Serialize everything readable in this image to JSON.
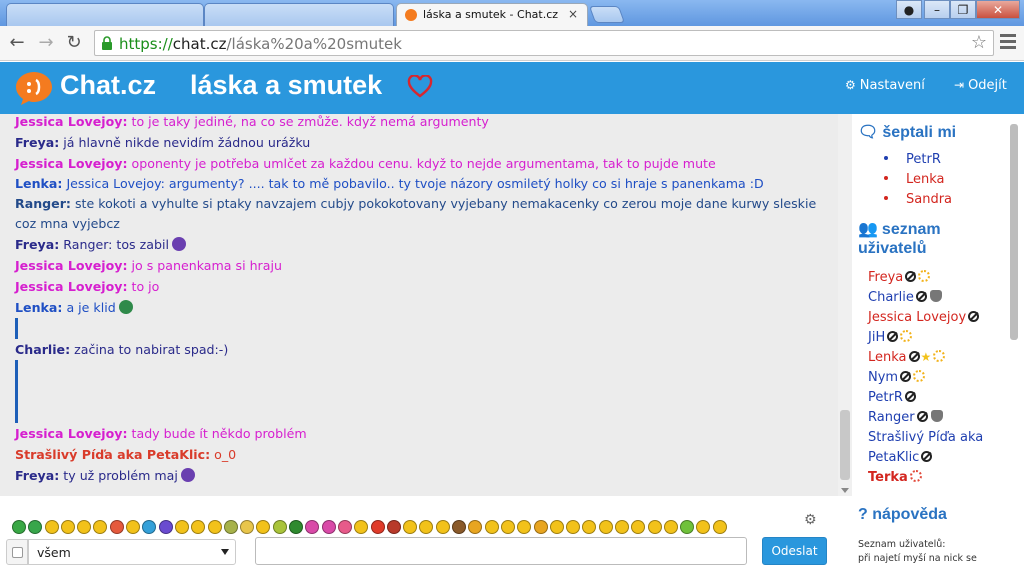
{
  "browser": {
    "tabs": [
      {
        "title": ""
      },
      {
        "title": ""
      },
      {
        "title": "láska a smutek - Chat.cz",
        "close": "×"
      }
    ],
    "url": {
      "scheme": "https://",
      "host": "chat.cz",
      "path": "/láska%20a%20smutek"
    },
    "window_buttons": {
      "min": "–",
      "max": "❐",
      "close": "✕"
    }
  },
  "header": {
    "brand": "Chat.cz",
    "room": "láska a smutek",
    "settings_label": "Nastavení",
    "logout_label": "Odejít",
    "accent": "#2a97dd"
  },
  "chat": {
    "messages": [
      {
        "nick": "Jessica Lovejoy:",
        "text": "to je taky jediné, na co se zmůže. když nemá argumenty",
        "cls": "c-jessica"
      },
      {
        "nick": "Freya:",
        "text": "já hlavně nikde nevidím žádnou urážku",
        "cls": "c-freya"
      },
      {
        "nick": "Jessica Lovejoy:",
        "text": "oponenty je potřeba umlčet za každou cenu. když to nejde argumentama, tak to pujde mute",
        "cls": "c-jessica"
      },
      {
        "nick": "Lenka:",
        "text": "Jessica Lovejoy: argumenty? .... tak to mě pobavilo.. ty tvoje názory osmiletý holky co si hraje s panenkama :D",
        "cls": "c-lenka"
      },
      {
        "nick": "Ranger:",
        "text": "ste kokoti a vyhulte si ptaky navzajem cubjy pokokotovany vyjebany nemakacenky co zerou moje dane kurwy sleskie coz mna vyjebcz",
        "cls": "c-ranger"
      },
      {
        "nick": "Freya:",
        "text": "Ranger: tos zabil",
        "cls": "c-freya"
      },
      {
        "nick": "Jessica Lovejoy:",
        "text": "jo s panenkama si hraju",
        "cls": "c-jessica"
      },
      {
        "nick": "Jessica Lovejoy:",
        "text": "to jo",
        "cls": "c-jessica"
      },
      {
        "nick": "Lenka:",
        "text": "a je klid",
        "cls": "c-lenka"
      },
      {
        "nick": "Charlie:",
        "text": "začina to nabirat spad:-)",
        "cls": "c-charlie"
      },
      {
        "nick": "Jessica Lovejoy:",
        "text": "tady bude ít někdo problém",
        "cls": "c-jessica"
      },
      {
        "nick": "Strašlivý Píďa aka PetaKlic:",
        "text": "o_0",
        "cls": "c-strasl"
      },
      {
        "nick": "Freya:",
        "text": "ty už problém maj",
        "cls": "c-freya"
      }
    ]
  },
  "sidebar": {
    "whisper_title": "šeptali mi",
    "whispers": [
      {
        "name": "PetrR",
        "color": "#1f3fb0"
      },
      {
        "name": "Lenka",
        "color": "#d3261f"
      },
      {
        "name": "Sandra",
        "color": "#d3261f"
      }
    ],
    "users_title_1": "seznam",
    "users_title_2": "uživatelů",
    "users": [
      {
        "name": "Freya",
        "color": "#d3261f",
        "badges": [
          "sun"
        ]
      },
      {
        "name": "Charlie",
        "color": "#1f3fb0",
        "badges": [
          "spy"
        ]
      },
      {
        "name": "Jessica Lovejoy",
        "color": "#d3261f",
        "badges": []
      },
      {
        "name": "JiH",
        "color": "#1f3fb0",
        "badges": [
          "sun"
        ]
      },
      {
        "name": "Lenka",
        "color": "#d3261f",
        "badges": [
          "star",
          "sun"
        ]
      },
      {
        "name": "Nym",
        "color": "#1f3fb0",
        "badges": [
          "sun"
        ]
      },
      {
        "name": "PetrR",
        "color": "#1f3fb0",
        "badges": []
      },
      {
        "name": "Ranger",
        "color": "#1f3fb0",
        "badges": [
          "spy"
        ]
      },
      {
        "name": "Strašlivý Píďa aka",
        "color": "#1f3fb0",
        "badges": []
      },
      {
        "name": "PetaKlic",
        "color": "#1f3fb0",
        "badges": []
      },
      {
        "name": "Terka",
        "color": "#d3261f",
        "bold": true,
        "badges": [
          "sun-red"
        ]
      }
    ],
    "help_title": "nápověda",
    "help_text_1": "Seznam uživatelů:",
    "help_text_2": "při najetí myší na nick se"
  },
  "input": {
    "recipient": "všem",
    "send_label": "Odeslat",
    "emoji_colors": [
      "#39a845",
      "#38a64b",
      "#f2c21a",
      "#f2c21a",
      "#f2c21a",
      "#f2c21a",
      "#e55a3d",
      "#f2c21a",
      "#34a0d9",
      "#6a4bd0",
      "#f2c21a",
      "#f2c21a",
      "#f2c21a",
      "#a7b24a",
      "#e8c54b",
      "#f2c21a",
      "#a9c43a",
      "#2f8a2f",
      "#d94aa8",
      "#d94aa8",
      "#e75a8a",
      "#f2c21a",
      "#e03b2a",
      "#b83a2a",
      "#f2c21a",
      "#f2c21a",
      "#f2c21a",
      "#8a5a2a",
      "#e8a520",
      "#f2c21a",
      "#f2c21a",
      "#f2c21a",
      "#e8a520",
      "#f2c21a",
      "#f2c21a",
      "#f2c21a",
      "#f2c21a",
      "#f2c21a",
      "#f2c21a",
      "#f2c21a",
      "#f2c21a",
      "#6fc13a",
      "#f2c21a",
      "#f2c21a"
    ]
  }
}
